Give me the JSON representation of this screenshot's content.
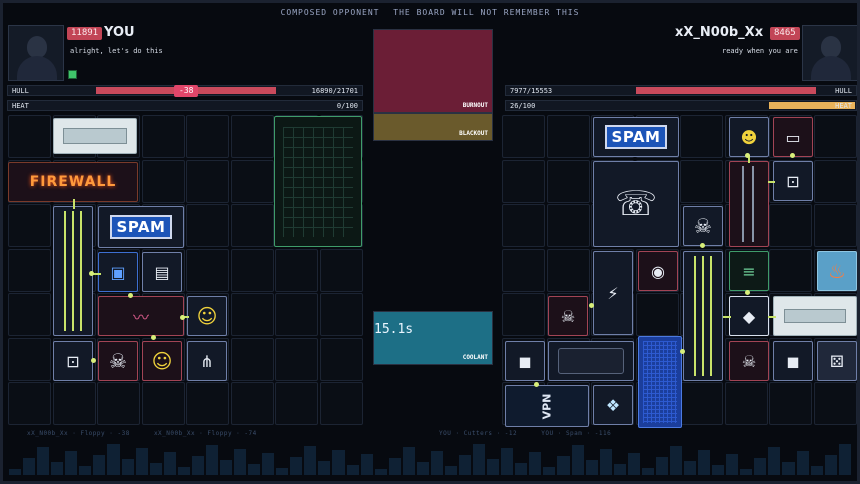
{
  "banner": {
    "left": "COMPOSED OPPONENT",
    "right": "THE BOARD WILL NOT REMEMBER THIS"
  },
  "player": {
    "score": "11891",
    "name": "YOU",
    "message": "alright, let's do this",
    "hull": {
      "label": "HULL",
      "value": "16890/21701",
      "delta": "-38",
      "fraction": 0.778
    },
    "heat": {
      "label": "HEAT",
      "value": "0/100",
      "fraction": 0.0
    }
  },
  "opponent": {
    "score": "8465",
    "name": "xX_N00b_Xx",
    "message": "ready when you are",
    "hull": {
      "label": "HULL",
      "value": "7977/15553",
      "fraction": 0.513
    },
    "heat": {
      "label": "HEAT",
      "value": "26/100",
      "fraction": 0.26
    }
  },
  "center": {
    "burnout_label": "BURNOUT",
    "blackout_label": "BLACKOUT",
    "coolant_label": "COOLANT",
    "timer": "15.1s",
    "colors": {
      "burnout": "#6b1e36",
      "blackout": "#6a5a2c",
      "coolant": "#1d6f86"
    }
  },
  "player_items": {
    "spam": "SPAM",
    "firewall": "FIREWALL",
    "icons": [
      "battery-icon",
      "firewall-sign",
      "spam-sign",
      "circuit-chip-icon",
      "server-rack-icon",
      "cable-icon",
      "smiley-mug-icon",
      "power-socket-icon",
      "skull-icon",
      "smiley-mug-icon",
      "claw-tool-icon",
      "grid-panel-icon"
    ]
  },
  "opponent_items": {
    "spam": "SPAM",
    "vpn": "VPN",
    "icons": [
      "spam-sign",
      "smiley-cube-icon",
      "memory-chip-icon",
      "phone-book-icon",
      "power-socket-icon",
      "skull-icon",
      "floppy-disk-icon",
      "fire-icon",
      "plug-icon",
      "cube-icon",
      "tablet-icon",
      "blue-grid-icon",
      "battery-icon",
      "skull-icon",
      "cube-icon",
      "dice-icon",
      "vpn-box-icon",
      "ice-cube-icon"
    ]
  },
  "log": {
    "left": [
      "xX_N00b_Xx · Floppy · -38",
      "xX_N00b_Xx · Floppy · -74"
    ],
    "right": [
      "YOU · Cutters · -12",
      "YOU · Spam · -116"
    ]
  }
}
